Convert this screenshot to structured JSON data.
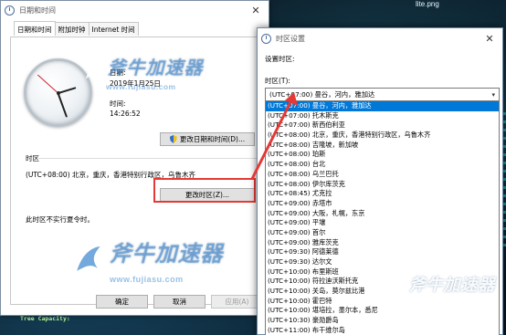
{
  "background": {
    "file_label": "lite.png",
    "footer_text": "Tree Capacity:"
  },
  "main_dialog": {
    "title": "日期和时间",
    "close_label": "✕",
    "tabs": [
      {
        "label": "日期和时间",
        "active": true
      },
      {
        "label": "附加时钟",
        "active": false
      },
      {
        "label": "Internet 时间",
        "active": false
      }
    ],
    "date_label": "日期:",
    "date_value": "2019年1月25日",
    "time_label": "时间:",
    "time_value": "14:26:52",
    "change_datetime_button": "更改日期和时间(D)...",
    "timezone_section_label": "时区",
    "timezone_value": "(UTC+08:00) 北京，重庆，香港特别行政区，乌鲁木齐",
    "change_timezone_button": "更改时区(Z)...",
    "dst_note": "此时区不实行夏令时。",
    "ok_button": "确定",
    "cancel_button": "取消",
    "apply_button": "应用(A)"
  },
  "timezone_dialog": {
    "title": "时区设置",
    "close_label": "✕",
    "set_label": "设置时区:",
    "field_label": "时区(T):",
    "selected_value": "(UTC+07:00) 曼谷，河内，雅加达",
    "options": [
      "(UTC+07:00) 曼谷，河内，雅加达",
      "(UTC+07:00) 托木斯克",
      "(UTC+07:00) 新西伯利亚",
      "(UTC+08:00) 北京，重庆，香港特别行政区，乌鲁木齐",
      "(UTC+08:00) 吉隆坡，新加坡",
      "(UTC+08:00) 珀斯",
      "(UTC+08:00) 台北",
      "(UTC+08:00) 乌兰巴托",
      "(UTC+08:00) 伊尔库茨克",
      "(UTC+08:45) 尤克拉",
      "(UTC+09:00) 赤塔市",
      "(UTC+09:00) 大阪，札幌，东京",
      "(UTC+09:00) 平壤",
      "(UTC+09:00) 首尔",
      "(UTC+09:00) 雅库茨克",
      "(UTC+09:30) 阿德莱德",
      "(UTC+09:30) 达尔文",
      "(UTC+10:00) 布里斯班",
      "(UTC+10:00) 符拉迪沃斯托克",
      "(UTC+10:00) 关岛，莫尔兹比港",
      "(UTC+10:00) 霍巴特",
      "(UTC+10:00) 堪培拉，墨尔本，悉尼",
      "(UTC+10:30) 豪勋爵岛",
      "(UTC+11:00) 布干维尔岛"
    ]
  },
  "watermark": {
    "logo": "斧牛加速器",
    "url": "www.fujiasu.com",
    "url_2": "www.fujiasu.com"
  },
  "colors": {
    "accent": "#0078d7",
    "highlight_red": "#e53935"
  }
}
